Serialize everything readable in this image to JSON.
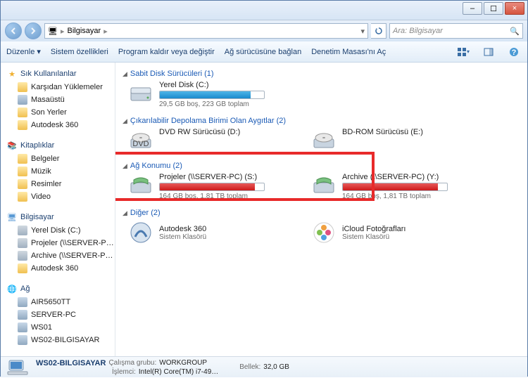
{
  "window": {
    "minimize": "–",
    "maximize": "☐",
    "close": "×"
  },
  "nav": {
    "location_icon": "🖥",
    "location": "Bilgisayar",
    "sep": "▸",
    "search_placeholder": "Ara: Bilgisayar"
  },
  "toolbar": {
    "organize": "Düzenle",
    "props": "Sistem özellikleri",
    "uninstall": "Program kaldır veya değiştir",
    "mapnet": "Ağ sürücüsüne bağlan",
    "ctrlpanel": "Denetim Masası'nı Aç"
  },
  "sidebar": {
    "fav": {
      "label": "Sık Kullanılanlar",
      "items": [
        "Karşıdan Yüklemeler",
        "Masaüstü",
        "Son Yerler",
        "Autodesk 360"
      ]
    },
    "lib": {
      "label": "Kitaplıklar",
      "items": [
        "Belgeler",
        "Müzik",
        "Resimler",
        "Video"
      ]
    },
    "comp": {
      "label": "Bilgisayar",
      "items": [
        "Yerel Disk (C:)",
        "Projeler (\\\\SERVER-P…",
        "Archive (\\\\SERVER-P…",
        "Autodesk 360"
      ]
    },
    "net": {
      "label": "Ağ",
      "items": [
        "AIR5650TT",
        "SERVER-PC",
        "WS01",
        "WS02-BILGISAYAR"
      ]
    }
  },
  "sections": {
    "hdd": {
      "title": "Sabit Disk Sürücüleri (1)",
      "items": [
        {
          "name": "Yerel Disk (C:)",
          "sub": "29,5 GB boş, 223 GB toplam",
          "fill": 87,
          "color": "blue"
        }
      ]
    },
    "removable": {
      "title": "Çıkarılabilir Depolama Birimi Olan Aygıtlar (2)",
      "items": [
        {
          "name": "DVD RW Sürücüsü (D:)"
        },
        {
          "name": "BD-ROM Sürücüsü (E:)"
        }
      ]
    },
    "netloc": {
      "title": "Ağ Konumu (2)",
      "items": [
        {
          "name": "Projeler (\\\\SERVER-PC) (S:)",
          "sub": "164 GB boş, 1,81 TB toplam",
          "fill": 91,
          "color": "red"
        },
        {
          "name": "Archive (\\\\SERVER-PC) (Y:)",
          "sub": "164 GB boş, 1,81 TB toplam",
          "fill": 91,
          "color": "red"
        }
      ]
    },
    "other": {
      "title": "Diğer (2)",
      "items": [
        {
          "name": "Autodesk 360",
          "sub": "Sistem Klasörü"
        },
        {
          "name": "iCloud Fotoğrafları",
          "sub": "Sistem Klasörü"
        }
      ]
    }
  },
  "status": {
    "name": "WS02-BILGISAYAR",
    "workgroup_label": "Çalışma grubu:",
    "workgroup": "WORKGROUP",
    "cpu_label": "İşlemci:",
    "cpu": "Intel(R) Core(TM) i7-49…",
    "mem_label": "Bellek:",
    "mem": "32,0 GB"
  }
}
